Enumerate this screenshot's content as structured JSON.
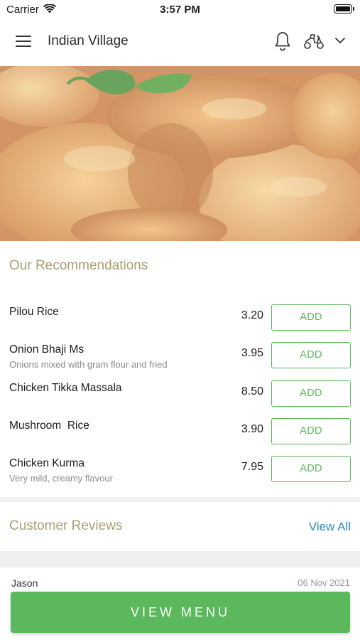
{
  "status_bar": {
    "carrier": "Carrier",
    "time": "3:57 PM"
  },
  "header": {
    "title": "Indian Village",
    "icons": [
      "menu-icon",
      "bell-icon",
      "scooter-icon",
      "chevron-down-icon"
    ]
  },
  "recommendations": {
    "title": "Our Recommendations",
    "add_label": "ADD",
    "items": [
      {
        "name": "Pilou Rice",
        "description": "",
        "price": "3.20"
      },
      {
        "name": "Onion Bhaji Ms",
        "description": "Onions mixed with gram flour and fried",
        "price": "3.95"
      },
      {
        "name": "Chicken Tikka Massala",
        "description": "",
        "price": "8.50"
      },
      {
        "name": "Mushroom  Rice",
        "description": "",
        "price": "3.90"
      },
      {
        "name": "Chicken Kurma",
        "description": "Very mild, creamy flavour",
        "price": "7.95"
      }
    ]
  },
  "reviews": {
    "title": "Customer Reviews",
    "view_all": "View All",
    "first": {
      "name": "Jason",
      "date": "06 Nov 2021"
    }
  },
  "footer": {
    "view_menu": "VIEW MENU"
  },
  "colors": {
    "accent_green": "#5cb85c",
    "section_title": "#a79e74",
    "link_blue": "#2f8fba"
  }
}
